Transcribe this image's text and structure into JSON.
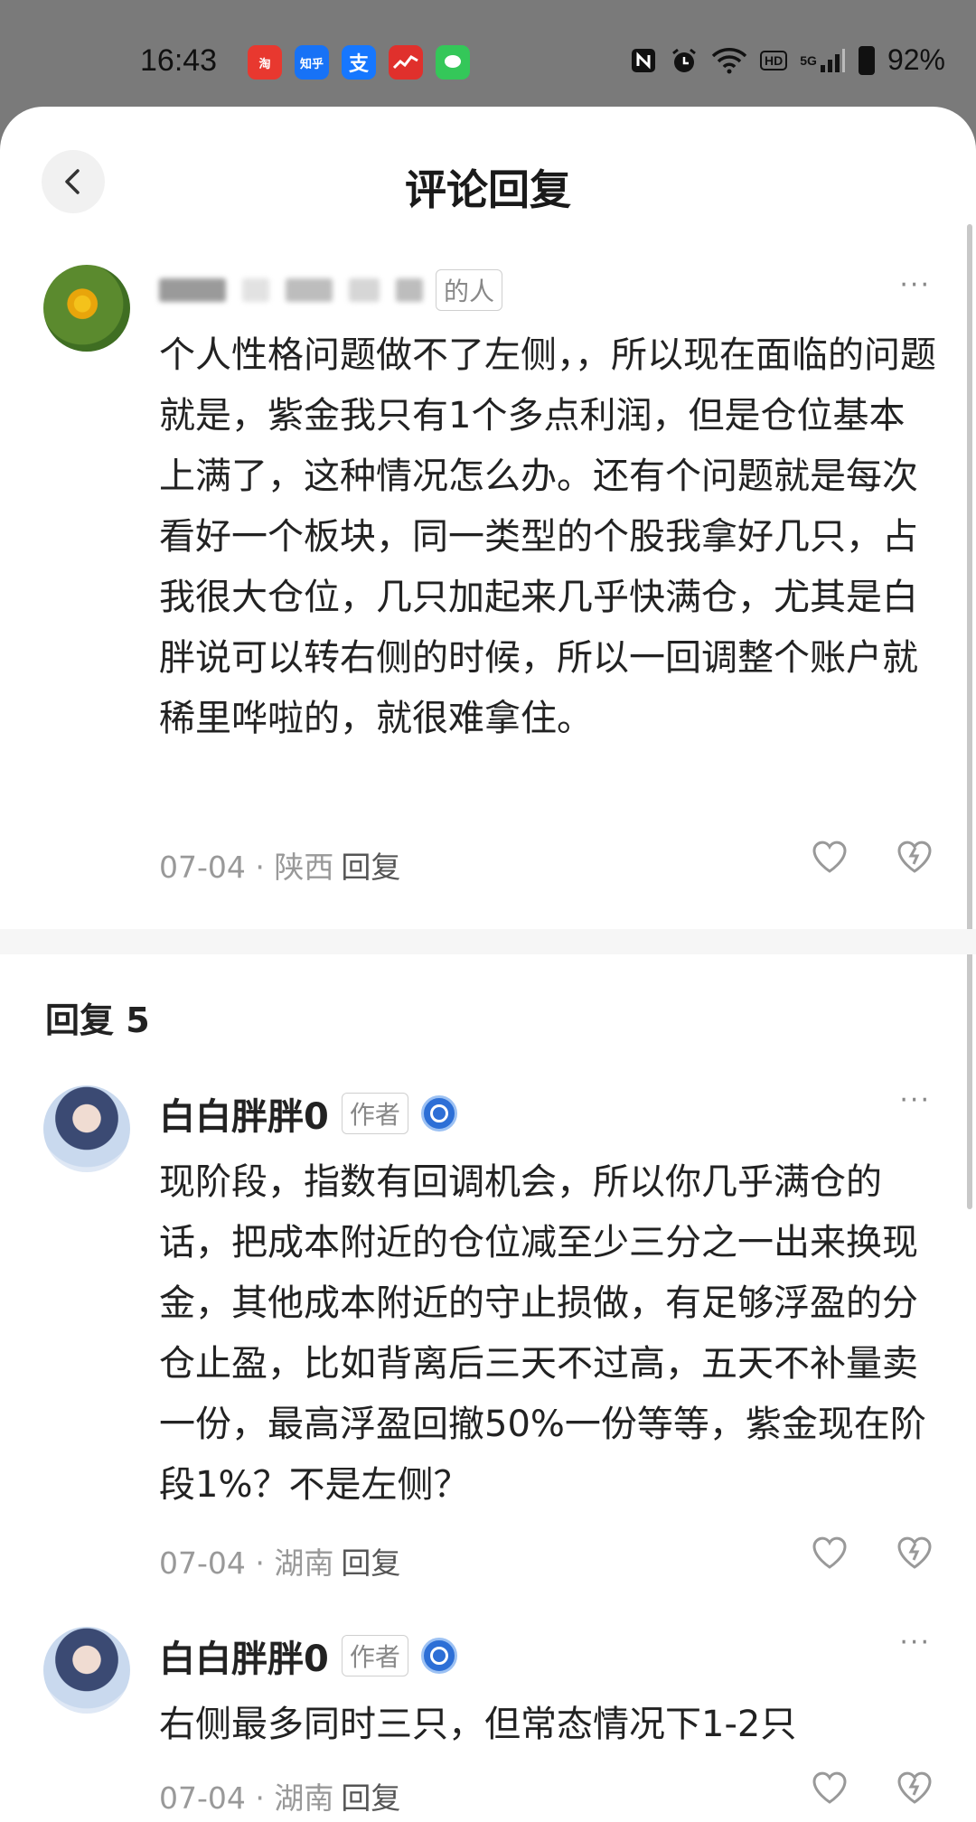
{
  "status_bar": {
    "time": "16:43",
    "apps": [
      {
        "name": "淘宝特价",
        "icon": "taobao-icon",
        "color": "#e8382f"
      },
      {
        "name": "知乎",
        "icon": "zhihu-icon",
        "color": "#1772f6"
      },
      {
        "name": "支付宝",
        "icon": "alipay-icon",
        "color": "#1677ff"
      },
      {
        "name": "股票",
        "icon": "stock-app-icon",
        "color": "#e0302c"
      },
      {
        "name": "信息",
        "icon": "message-icon",
        "color": "#34c759"
      }
    ],
    "hd": "HD",
    "network": "5G",
    "battery": "92%"
  },
  "header": {
    "title": "评论回复",
    "back_icon": "chevron-left-icon"
  },
  "main_comment": {
    "tag": "的人",
    "text": "个人性格问题做不了左侧，，所以现在面临的问题就是，紫金我只有1个多点利润，但是仓位基本上满了，这种情况怎么办。还有个问题就是每次看好一个板块，同一类型的个股我拿好几只，占我很大仓位，几只加起来几乎快满仓，尤其是白胖说可以转右侧的时候，所以一回调整个账户就稀里哗啦的，就很难拿住。",
    "date": "07-04",
    "location": "陕西",
    "reply_label": "回复",
    "more": "···"
  },
  "replies_header": "回复 5",
  "replies": [
    {
      "name": "白白胖胖0",
      "tag": "作者",
      "text": "现阶段，指数有回调机会，所以你几乎满仓的话，把成本附近的仓位减至少三分之一出来换现金，其他成本附近的守止损做，有足够浮盈的分仓止盈，比如背离后三天不过高，五天不补量卖一份，最高浮盈回撤50%一份等等，紫金现在阶段1%？不是左侧？",
      "date": "07-04",
      "location": "湖南",
      "reply_label": "回复",
      "more": "···"
    },
    {
      "name": "白白胖胖0",
      "tag": "作者",
      "text": "右侧最多同时三只，但常态情况下1-2只",
      "date": "07-04",
      "location": "湖南",
      "reply_label": "回复",
      "more": "···"
    }
  ],
  "separator": " · "
}
